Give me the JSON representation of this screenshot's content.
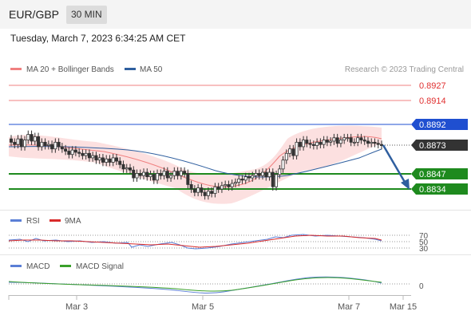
{
  "header": {
    "pair": "EUR/GBP",
    "timeframe": "30 MIN"
  },
  "timestamp": "Tuesday, March 7, 2023 6:34:25 AM CET",
  "legend": {
    "ma20": "MA 20 + Bollinger Bands",
    "ma50": "MA 50",
    "copyright": "Research © 2023 Trading Central",
    "rsi": "RSI",
    "rsi_ma": "9MA",
    "macd": "MACD",
    "macd_signal": "MACD Signal"
  },
  "colors": {
    "ma20": "#f08080",
    "ma50": "#2f5f9f",
    "support": "#1e8a1e",
    "resistance_red": "#f08080",
    "pivot_blue": "#1f4fd0",
    "price_box": "#333333",
    "rsi": "#5b7fd6",
    "rsi_ma": "#d92b2b",
    "macd": "#5b7fd6",
    "macd_signal": "#3aa02a"
  },
  "levels": {
    "r3": "0.8927",
    "r2": "0.8914",
    "r1": "0.8892",
    "last": "0.8873",
    "s1": "0.8847",
    "s2": "0.8834"
  },
  "rsi_ticks": [
    "70",
    "50",
    "30"
  ],
  "macd_ticks": [
    "0"
  ],
  "x_axis": [
    "Mar 3",
    "Mar 5",
    "Mar 7",
    "Mar 15"
  ],
  "chart_data": {
    "type": "candlestick",
    "y_range": [
      0.8815,
      0.8945
    ],
    "close": [
      0.8876,
      0.8874,
      0.8879,
      0.8872,
      0.8878,
      0.8883,
      0.8877,
      0.8881,
      0.8872,
      0.8876,
      0.8873,
      0.8874,
      0.887,
      0.8876,
      0.8872,
      0.887,
      0.8868,
      0.8865,
      0.8869,
      0.8867,
      0.8866,
      0.8864,
      0.8866,
      0.8862,
      0.8864,
      0.886,
      0.8862,
      0.8858,
      0.8861,
      0.8858,
      0.8862,
      0.8859,
      0.8856,
      0.8852,
      0.8853,
      0.8851,
      0.8844,
      0.8848,
      0.8846,
      0.8849,
      0.8845,
      0.8847,
      0.8842,
      0.8848,
      0.8846,
      0.885,
      0.8844,
      0.8846,
      0.885,
      0.8846,
      0.885,
      0.8848,
      0.8838,
      0.8834,
      0.8831,
      0.8835,
      0.8831,
      0.8828,
      0.8832,
      0.883,
      0.8836,
      0.8834,
      0.8837,
      0.8838,
      0.8836,
      0.8839,
      0.884,
      0.8843,
      0.8842,
      0.8845,
      0.8844,
      0.8846,
      0.8848,
      0.8846,
      0.8849,
      0.8845,
      0.8849,
      0.8836,
      0.8847,
      0.8852,
      0.886,
      0.8866,
      0.887,
      0.8864,
      0.8876,
      0.8872,
      0.8878,
      0.8875,
      0.8874,
      0.8873,
      0.8876,
      0.8874,
      0.8878,
      0.8876,
      0.8877,
      0.888,
      0.8875,
      0.8878,
      0.888,
      0.888,
      0.8876,
      0.8876,
      0.888,
      0.8878,
      0.8877,
      0.8875,
      0.8876,
      0.8875,
      0.8874,
      0.8873
    ]
  }
}
